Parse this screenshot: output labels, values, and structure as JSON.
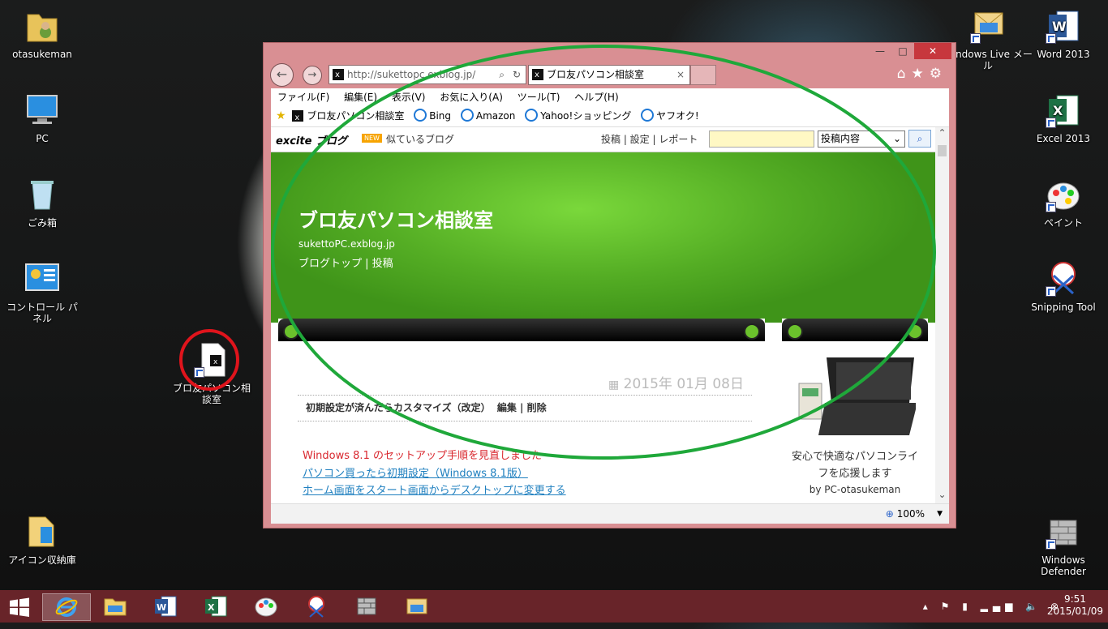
{
  "desktop": {
    "icons_left": [
      {
        "label": "otasukeman"
      },
      {
        "label": "PC"
      },
      {
        "label": "ごみ箱"
      },
      {
        "label": "コントロール パネル"
      },
      {
        "label": "アイコン収納庫"
      }
    ],
    "shortcut_icon": {
      "label": "ブロ友パソコン相談室"
    },
    "icons_right": [
      {
        "label": "Windows Live メール"
      },
      {
        "label": "Word 2013"
      },
      {
        "label": "Excel 2013"
      },
      {
        "label": "ペイント"
      },
      {
        "label": "Snipping Tool"
      },
      {
        "label": "Windows Defender"
      }
    ]
  },
  "browser": {
    "window_buttons": {
      "minimize": "—",
      "maximize": "□",
      "close": "✕"
    },
    "address": "http://sukettopc.exblog.jp/",
    "tab_title": "ブロ友パソコン相談室",
    "tab_close": "×",
    "menu": [
      "ファイル(F)",
      "編集(E)",
      "表示(V)",
      "お気に入り(A)",
      "ツール(T)",
      "ヘルプ(H)"
    ],
    "favorites": [
      "ブロ友パソコン相談室",
      "Bing",
      "Amazon",
      "Yahoo!ショッピング",
      "ヤフオク!"
    ],
    "zoom": "100%"
  },
  "page": {
    "excite_logo": "excite ブログ",
    "new_badge": "NEW",
    "similar_blogs": "似ているブログ",
    "links": "投稿 | 設定 | レポート",
    "search_select": "投稿内容",
    "blog_title": "ブロ友パソコン相談室",
    "blog_url": "sukettoPC.exblog.jp",
    "blog_nav": "ブログトップ | 投稿",
    "post_date": "2015年 01月 08日",
    "post_title": "初期設定が済んだらカスタマイズ（改定）",
    "post_actions": "編集 | 削除",
    "post_red_line": "Windows 8.1 のセットアップ手順を見直しました",
    "post_link1": "パソコン買ったら初期設定（Windows 8.1版）",
    "post_link2": "ホーム画面をスタート画面からデスクトップに変更する",
    "sidebar_text": "安心で快適なパソコンライフを応援します",
    "sidebar_by": "by PC-otasukeman"
  },
  "taskbar": {
    "time": "9:51",
    "date": "2015/01/09"
  },
  "colors": {
    "annotation_green": "#1fa83a",
    "annotation_red": "#e0141c",
    "window_frame": "#d98f93",
    "taskbar": "#782e34"
  }
}
